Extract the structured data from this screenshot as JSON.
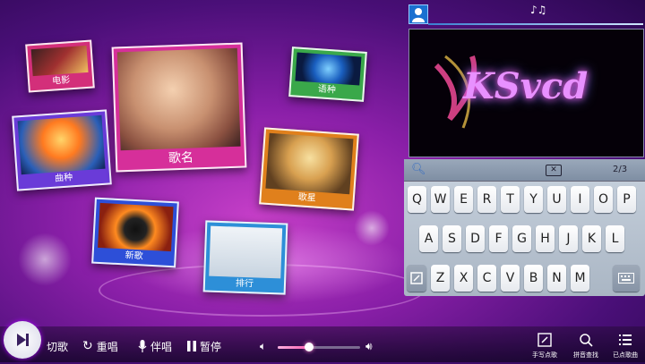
{
  "tiles": {
    "dianying": "电影",
    "quzhong": "曲种",
    "geming": "歌名",
    "yuzhong": "语种",
    "gexing": "歌星",
    "xinge": "新歌",
    "paihang": "排行"
  },
  "preview": {
    "logo_text": "KSvcd"
  },
  "keyboard": {
    "row1": [
      "Q",
      "W",
      "E",
      "R",
      "T",
      "Y",
      "U",
      "I",
      "O",
      "P"
    ],
    "row2": [
      "A",
      "S",
      "D",
      "F",
      "G",
      "H",
      "J",
      "K",
      "L"
    ],
    "row3": [
      "Z",
      "X",
      "C",
      "V",
      "B",
      "N",
      "M"
    ],
    "number_toggle": "2/3"
  },
  "controls": {
    "next": "切歌",
    "replay": "重唱",
    "accompany": "伴唱",
    "pause": "暂停",
    "volume": 0.38
  },
  "side_actions": {
    "handwrite": "手写点歌",
    "pinyin": "拼音查找",
    "ordered": "已点歌曲"
  },
  "colors": {
    "accent_pink": "#d62f9a",
    "accent_blue": "#2d8fd8",
    "accent_green": "#3aa84a",
    "accent_orange": "#e0801c",
    "accent_purple": "#6a3bd8"
  }
}
